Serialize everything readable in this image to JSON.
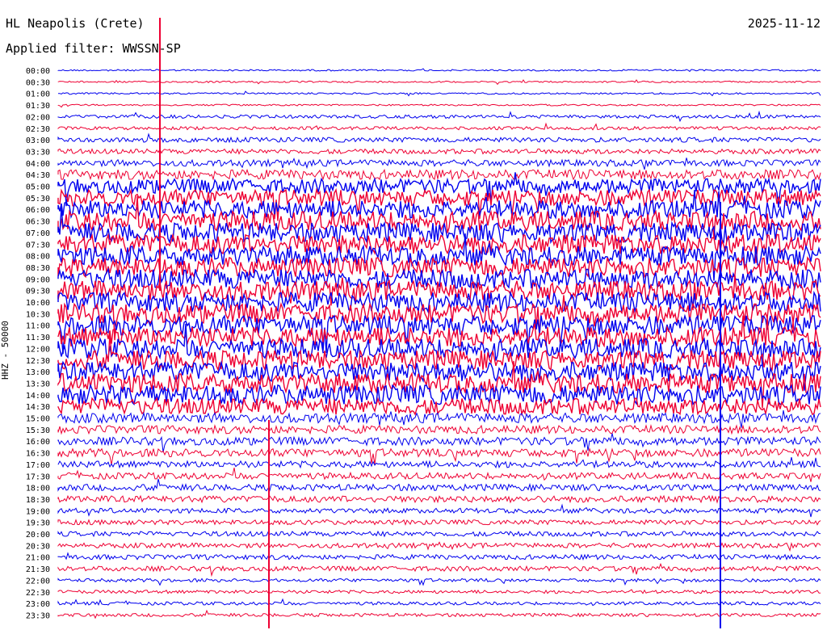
{
  "station": "HL Neapolis (Crete)",
  "date": "2025-11-12",
  "filter_text": "Applied filter: WWSSN-SP",
  "channel_label": "HHZ - 50000",
  "colors": {
    "a": "#0000ee",
    "b": "#ee0033",
    "text": "#000000"
  },
  "chart_data": {
    "type": "line",
    "title": "HL Neapolis (Crete)",
    "ylabel": "HHZ - 50000",
    "traces": [
      "00:00",
      "00:30",
      "01:00",
      "01:30",
      "02:00",
      "02:30",
      "03:00",
      "03:30",
      "04:00",
      "04:30",
      "05:00",
      "05:30",
      "06:00",
      "06:30",
      "07:00",
      "07:30",
      "08:00",
      "08:30",
      "09:00",
      "09:30",
      "10:00",
      "10:30",
      "11:00",
      "11:30",
      "12:00",
      "12:30",
      "13:00",
      "13:30",
      "14:00",
      "14:30",
      "15:00",
      "15:30",
      "16:00",
      "16:30",
      "17:00",
      "17:30",
      "18:00",
      "18:30",
      "19:00",
      "19:30",
      "20:00",
      "20:30",
      "21:00",
      "21:30",
      "22:00",
      "22:30",
      "23:00",
      "23:30"
    ],
    "color_cycle": [
      "blue",
      "red"
    ],
    "noise_level": [
      1,
      1,
      1,
      1,
      2,
      2,
      3,
      3,
      4,
      6,
      9,
      10,
      11,
      12,
      12,
      12,
      12,
      12,
      12,
      12,
      12,
      12,
      12,
      12,
      12,
      12,
      12,
      12,
      12,
      10,
      6,
      5,
      5,
      5,
      4,
      4,
      4,
      4,
      3,
      3,
      3,
      3,
      3,
      3,
      2,
      2,
      2,
      2
    ]
  }
}
